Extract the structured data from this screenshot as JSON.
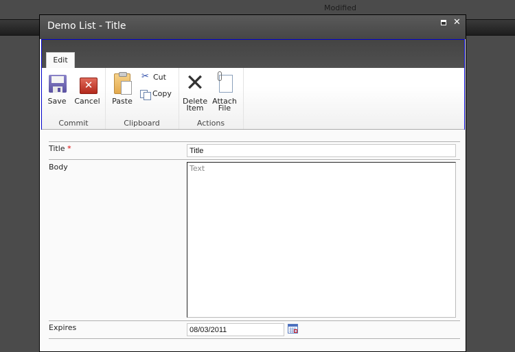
{
  "background": {
    "column_header": "Modified"
  },
  "dialog": {
    "title": "Demo List - Title",
    "maximize_icon": "maximize-icon",
    "close_icon": "close-icon"
  },
  "ribbon": {
    "tabs": [
      {
        "label": "Edit",
        "selected": true
      }
    ],
    "groups": [
      {
        "label": "Commit",
        "buttons": [
          {
            "label": "Save",
            "icon": "save-icon"
          },
          {
            "label": "Cancel",
            "icon": "cancel-icon"
          }
        ]
      },
      {
        "label": "Clipboard",
        "buttons": [
          {
            "label": "Paste",
            "icon": "paste-icon"
          },
          {
            "label": "Cut",
            "icon": "cut-icon"
          },
          {
            "label": "Copy",
            "icon": "copy-icon"
          }
        ]
      },
      {
        "label": "Actions",
        "buttons": [
          {
            "label_line1": "Delete",
            "label_line2": "Item",
            "icon": "delete-icon"
          },
          {
            "label_line1": "Attach",
            "label_line2": "File",
            "icon": "attach-icon"
          }
        ]
      }
    ]
  },
  "form": {
    "fields": [
      {
        "label": "Title",
        "required_marker": "*",
        "value": "Title"
      },
      {
        "label": "Body",
        "placeholder": "Text",
        "value": ""
      },
      {
        "label": "Expires",
        "value": "08/03/2011",
        "icon": "calendar-icon"
      }
    ]
  },
  "colors": {
    "ribbon_focus_border": "#0000cc",
    "required_marker": "#dd0000"
  }
}
